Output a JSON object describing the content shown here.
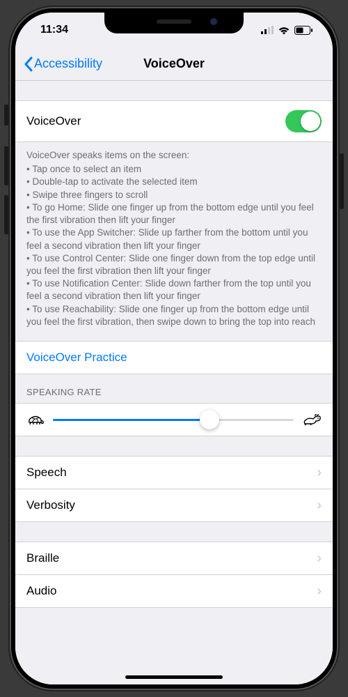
{
  "status": {
    "time": "11:34"
  },
  "nav": {
    "back_label": "Accessibility",
    "title": "VoiceOver"
  },
  "main_toggle": {
    "label": "VoiceOver",
    "on": true
  },
  "desc": {
    "intro": "VoiceOver speaks items on the screen:",
    "items": [
      "Tap once to select an item",
      "Double-tap to activate the selected item",
      "Swipe three fingers to scroll",
      "To go Home: Slide one finger up from the bottom edge until you feel the first vibration then lift your finger",
      "To use the App Switcher: Slide up farther from the bottom until you feel a second vibration then lift your finger",
      "To use Control Center: Slide one finger down from the top edge until you feel the first vibration then lift your finger",
      "To use Notification Center: Slide down farther from the top until you feel a second vibration then lift your finger",
      "To use Reachability: Slide one finger up from the bottom edge until you feel the first vibration, then swipe down to bring the top into reach"
    ]
  },
  "practice": {
    "label": "VoiceOver Practice"
  },
  "speaking_rate": {
    "header": "SPEAKING RATE",
    "value_percent": 65
  },
  "rows": {
    "speech": "Speech",
    "verbosity": "Verbosity",
    "braille": "Braille",
    "audio": "Audio"
  },
  "colors": {
    "tint": "#007aff",
    "toggle_on": "#34c759"
  }
}
